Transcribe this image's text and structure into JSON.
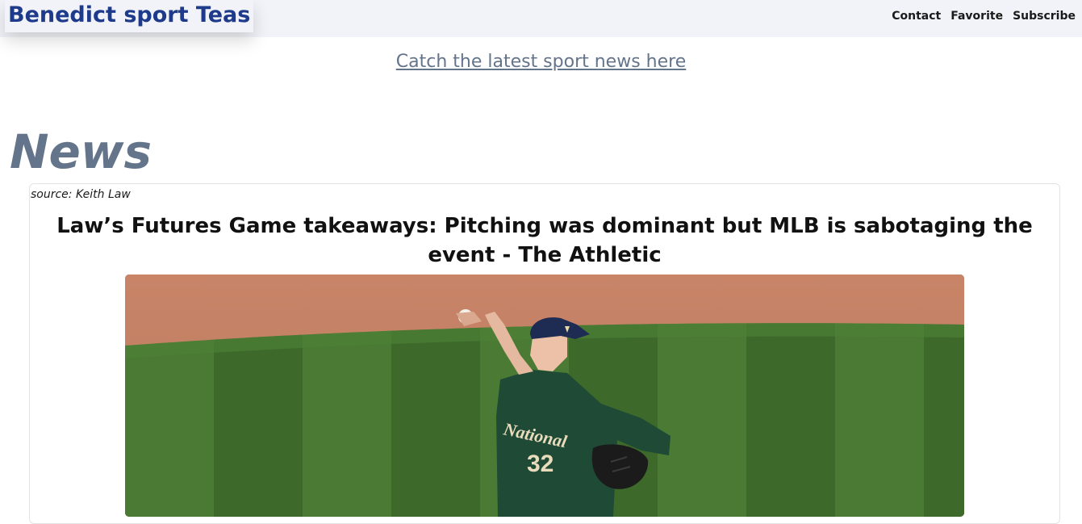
{
  "header": {
    "brand": "Benedict sport Teas",
    "nav": [
      {
        "label": "Contact"
      },
      {
        "label": "Favorite"
      },
      {
        "label": "Subscribe"
      }
    ]
  },
  "hero": {
    "tagline": "Catch the latest sport news here"
  },
  "news": {
    "section_title": "News",
    "articles": [
      {
        "source": "source: Keith Law",
        "headline": "Law’s Futures Game takeaways: Pitching was dominant but MLB is sabotaging the event - The Athletic",
        "image": {
          "jersey_text": "National",
          "jersey_number": "32"
        }
      }
    ]
  },
  "colors": {
    "brand": "#1e3a8a",
    "muted": "#64748b",
    "navbar_bg": "#f1f3f8"
  }
}
